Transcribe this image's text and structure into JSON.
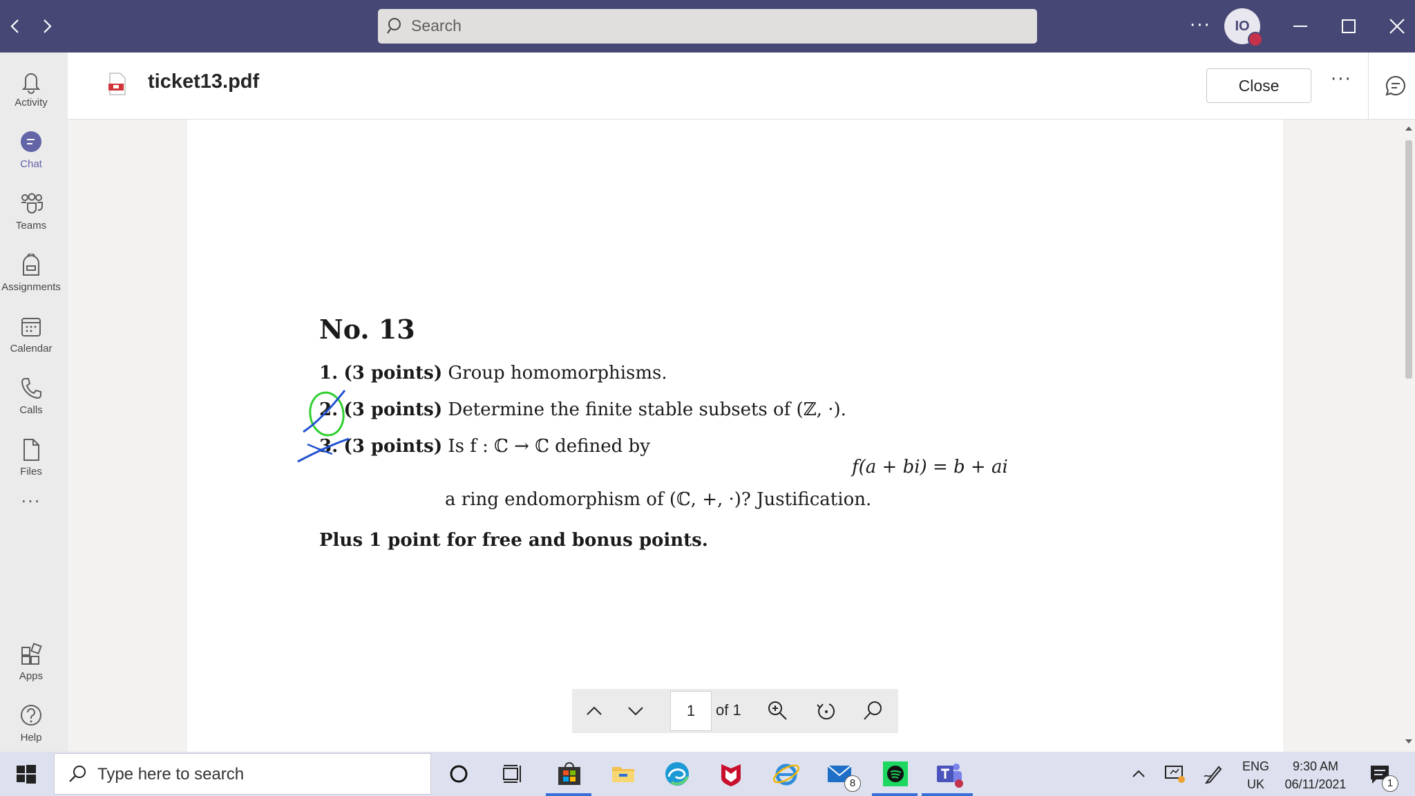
{
  "titlebar": {
    "search_placeholder": "Search",
    "avatar_initials": "IO",
    "more_label": "···"
  },
  "rail": {
    "items": [
      {
        "label": "Activity",
        "icon": "bell-icon"
      },
      {
        "label": "Chat",
        "icon": "chat-icon"
      },
      {
        "label": "Teams",
        "icon": "teams-icon"
      },
      {
        "label": "Assignments",
        "icon": "backpack-icon"
      },
      {
        "label": "Calendar",
        "icon": "calendar-icon"
      },
      {
        "label": "Calls",
        "icon": "phone-icon"
      },
      {
        "label": "Files",
        "icon": "file-icon"
      },
      {
        "label": "···",
        "icon": "more-icon"
      },
      {
        "label": "Apps",
        "icon": "apps-icon"
      },
      {
        "label": "Help",
        "icon": "help-icon"
      }
    ]
  },
  "header": {
    "file_name": "ticket13.pdf",
    "close_label": "Close",
    "more_label": "···"
  },
  "document": {
    "heading": "No.  13",
    "q1": {
      "num": "1.",
      "points": "(3 points)",
      "text": "Group homomorphisms."
    },
    "q2": {
      "num": "2.",
      "points": "(3 points)",
      "text": "Determine the finite stable subsets of (ℤ, ·)."
    },
    "q3": {
      "num": "3.",
      "points": "(3 points)",
      "text": "Is f : ℂ → ℂ defined by"
    },
    "q3_formula": "f(a + bi) = b + ai",
    "q3_cont": "a ring endomorphism of (ℂ, +, ·)? Justification.",
    "bonus": "Plus 1 point for free and bonus points."
  },
  "pdf_toolbar": {
    "page_value": "1",
    "page_of": "of 1"
  },
  "taskbar": {
    "search_placeholder": "Type here to search",
    "mail_badge": "8",
    "notif_badge": "1",
    "lang_top": "ENG",
    "lang_bottom": "UK",
    "time": "9:30 AM",
    "date": "06/11/2021"
  },
  "colors": {
    "titlebar": "#464775",
    "accent": "#6264a7",
    "ink_blue": "#1f4fd1",
    "ink_green": "#2fcf2f"
  }
}
